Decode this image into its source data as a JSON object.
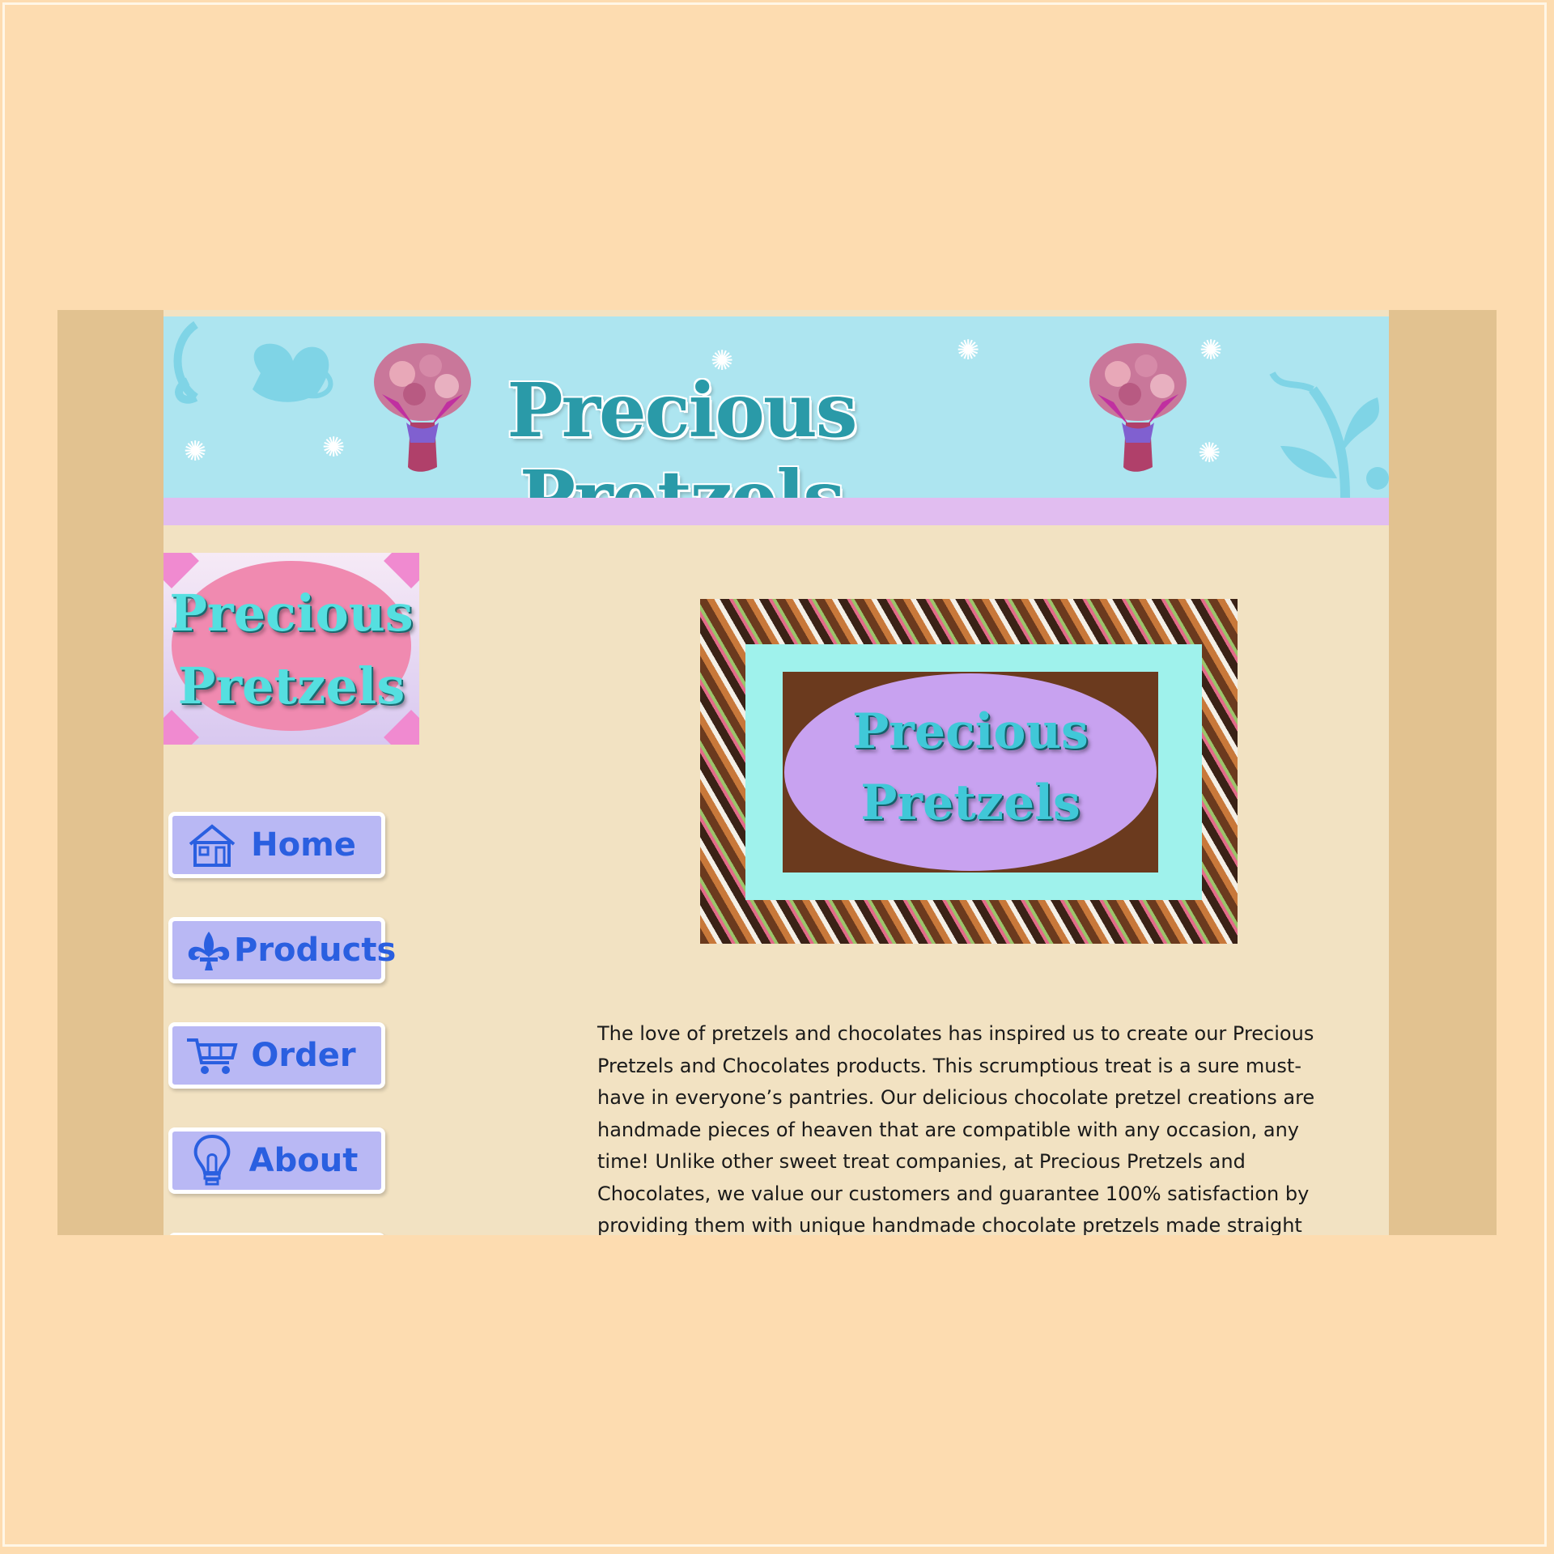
{
  "site": {
    "banner_title": "Precious Pretzels",
    "logo_line1": "Precious",
    "logo_line2": "Pretzels",
    "hero_line1": "Precious",
    "hero_line2": "Pretzels"
  },
  "nav": {
    "items": [
      {
        "label": "Home",
        "icon": "home-icon"
      },
      {
        "label": "Products",
        "icon": "fleur-de-lis-icon"
      },
      {
        "label": "Order",
        "icon": "shopping-cart-icon"
      },
      {
        "label": "About",
        "icon": "lightbulb-icon"
      }
    ]
  },
  "content": {
    "paragraph": "The love of pretzels and chocolates has inspired us to create our Precious Pretzels and Chocolates products. This scrumptious treat is a sure must-have in everyone’s pantries. Our delicious chocolate pretzel creations are handmade pieces of heaven that are compatible with any occasion, any time! Unlike other sweet treat companies, at Precious Pretzels and Chocolates, we value our customers and guarantee 100% satisfaction by providing them with unique handmade chocolate pretzels made straight"
  },
  "colors": {
    "outer_background": "#fddcb0",
    "page_background": "#f2e2c2",
    "banner": "#ade5f0",
    "banner_strip": "#e1bdf0",
    "nav_button": "#b9b8f4",
    "nav_text": "#2a5fe0",
    "title_teal": "#2a9aa8"
  }
}
